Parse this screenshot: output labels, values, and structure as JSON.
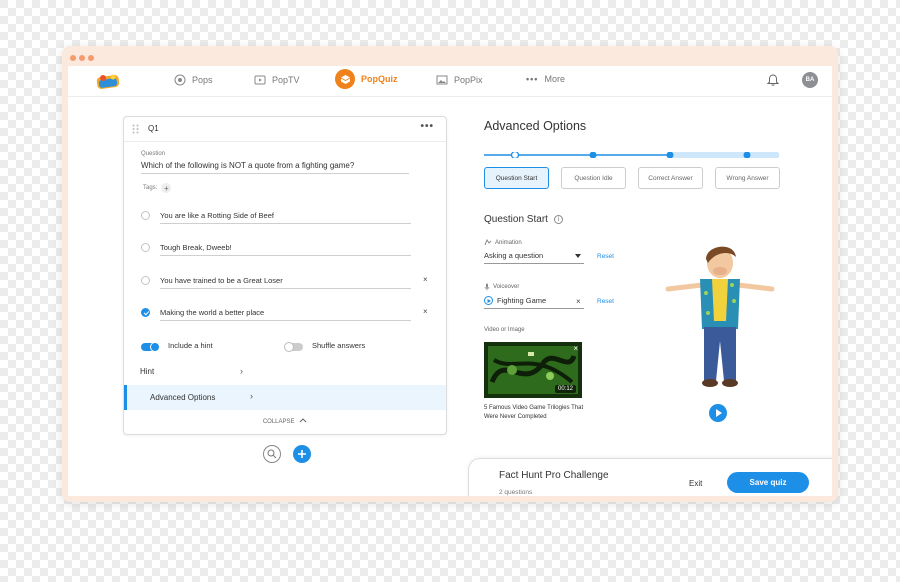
{
  "nav": {
    "items": [
      {
        "label": "Pops",
        "icon": "pops-icon"
      },
      {
        "label": "PopTV",
        "icon": "tv-icon"
      },
      {
        "label": "PopQuiz",
        "icon": "popquiz-icon",
        "active": true
      },
      {
        "label": "PopPix",
        "icon": "image-icon"
      },
      {
        "label": "More",
        "icon": "dots-icon"
      }
    ],
    "avatar_initials": "BA"
  },
  "question": {
    "number_label": "Q1",
    "menu_label": "•••",
    "field_label": "Question",
    "text": "Which of the following is NOT a quote from a fighting game?",
    "tags_label": "Tags:",
    "tags_add": "+",
    "answers": [
      {
        "text": "You are like a Rotting Side of Beef",
        "correct": false,
        "removable": false
      },
      {
        "text": "Tough Break, Dweeb!",
        "correct": false,
        "removable": false
      },
      {
        "text": "You have trained to be a Great Loser",
        "correct": false,
        "removable": true
      },
      {
        "text": "Making the world a better place",
        "correct": true,
        "removable": true
      }
    ],
    "remove_symbol": "×",
    "include_hint_label": "Include a hint",
    "include_hint_on": true,
    "shuffle_label": "Shuffle answers",
    "shuffle_on": false,
    "hint_label": "Hint",
    "advanced_label": "Advanced Options",
    "collapse_label": "COLLAPSE",
    "chevron": "›"
  },
  "advanced": {
    "title": "Advanced Options",
    "steps": [
      "Question Start",
      "Question Idle",
      "Correct Answer",
      "Wrong Answer"
    ],
    "active_step": 0,
    "section_title": "Question Start",
    "animation_label": "Animation",
    "animation_value": "Asking a question",
    "voiceover_label": "Voiceover",
    "voiceover_value": "Fighting Game",
    "reset_label": "Reset",
    "media_label": "Video or Image",
    "video_duration": "00:12",
    "video_caption": "5 Famous Video Game Trilogies That Were Never Completed"
  },
  "footer": {
    "quiz_name": "Fact Hunt Pro Challenge",
    "question_count": "2 questions",
    "exit_label": "Exit",
    "save_label": "Save quiz"
  },
  "colors": {
    "accent": "#1e8fe6",
    "brand_orange": "#f0821c",
    "frame": "#fbe9dd"
  }
}
